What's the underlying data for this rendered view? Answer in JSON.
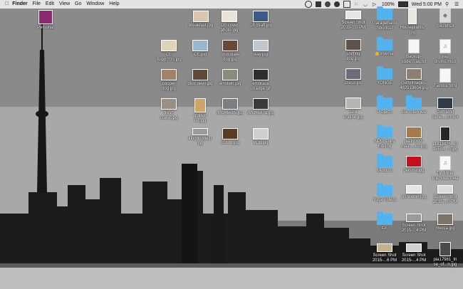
{
  "menubar": {
    "apple": "",
    "app": "Finder",
    "items": [
      "File",
      "Edit",
      "View",
      "Go",
      "Window",
      "Help"
    ],
    "battery": "100%",
    "clock": "Wed 5:00 PM"
  },
  "icons": {
    "personal": "Personal",
    "breakfast": "breakfast.jpg",
    "ce_cover": "CE cover\nphoto.jpg",
    "ce_staff": "CE Staff.jpg",
    "ce_supp": "CE\nSupp....rs.jpg",
    "ce": "CE.jpg",
    "chocolate": "chocolate\ndog.jpg",
    "slay": "slay.jpg",
    "cooper": "cooper\ndog.jpg",
    "dust": "dust devil.jpg",
    "einstein": "einstein.jpg",
    "embrace": "embrace\nchange.gif",
    "fresh": "fresh\ncrater.jpg",
    "golden": "golden\nret.jpg",
    "img5685": "IMG_5685.jpg",
    "img5871": "IMG_5871.jpg",
    "kingbridge": "kingbridge.p\nng",
    "lol1": "LOL 1.jpg",
    "lol": "LOL.jpg",
    "ss1": "Screen Shot\n2015-...0 PM",
    "garageband": "GarageBand\nShortcut",
    "houseplants": "Houseplants.\njpg",
    "gb2midi": "GB2MIDI",
    "sniffing": "sniffing\ndog.jpg",
    "inverse": "Inverse",
    "backup": "Backup-\ncode....ag.txt",
    "yas": "yas\ndrums.mp3",
    "stress": "stress.jpg",
    "yonge": "YONGE",
    "getty": "GettyImages-\n482913604.jpg",
    "factiva": "Factiva.html",
    "tank": "tank\nengine.jpg",
    "projects": "Projects",
    "joe": "Joe Interview",
    "girlfriend": "Girlfriend\nSerie....h.mov",
    "npg": "NPG Copy\nEditing",
    "pia19392": "pia19392-\nmain....es.jpg",
    "n11811475": "11811475_10\n15584...n.jpg",
    "mexicos": "Mexicos",
    "plasma": "plasma.jpg",
    "tor": "Tor Miller\nInterview.m4a",
    "yoga": "Yoga Videos",
    "princeton": "princeton.jpg",
    "ss2": "Screen Shot\n2015-...0 PM",
    "ce_folder": "CE",
    "ss3": "Screen Shot\n2015-...4 PM",
    "mecca": "mecca.jpg",
    "ss4": "Screen Shot\n2015-...6 PM",
    "ss5": "Screen Shot\n2015-...4 PM",
    "pia17981": "pia17981_tri\nse_of...n.jpg"
  },
  "colors": {
    "folder": "#51b3ef",
    "inverse_tag": "#f5b800"
  }
}
